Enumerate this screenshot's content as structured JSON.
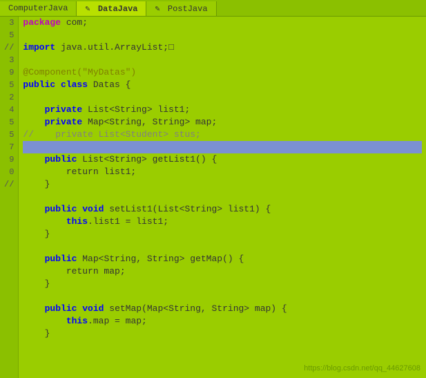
{
  "tabs": [
    {
      "label": "ComputerJava",
      "active": false,
      "icon": ""
    },
    {
      "label": "DataJava",
      "active": true,
      "icon": "✎"
    },
    {
      "label": "PostJava",
      "active": false,
      "icon": "✎"
    }
  ],
  "lines": [
    {
      "num": "",
      "code": "",
      "highlighted": false,
      "tokens": [
        {
          "text": "",
          "cls": "plain"
        }
      ]
    },
    {
      "num": "",
      "code": "package com;",
      "highlighted": false,
      "tokens": [
        {
          "text": "package",
          "cls": "kw"
        },
        {
          "text": " com;",
          "cls": "plain"
        }
      ]
    },
    {
      "num": "",
      "code": "",
      "highlighted": false,
      "tokens": []
    },
    {
      "num": "3",
      "code": "import java.util.ArrayList;□",
      "highlighted": false,
      "tokens": [
        {
          "text": "import",
          "cls": "kw2"
        },
        {
          "text": " java.util.ArrayList;□",
          "cls": "plain"
        }
      ]
    },
    {
      "num": "",
      "code": "",
      "highlighted": false,
      "tokens": []
    },
    {
      "num": "",
      "code": "@Component(\"MyDatas\")",
      "highlighted": false,
      "tokens": [
        {
          "text": "@Component(\"MyDatas\")",
          "cls": "ann"
        }
      ]
    },
    {
      "num": "",
      "code": "public class Datas {",
      "highlighted": false,
      "tokens": [
        {
          "text": "public",
          "cls": "kw2"
        },
        {
          "text": " ",
          "cls": "plain"
        },
        {
          "text": "class",
          "cls": "kw2"
        },
        {
          "text": " Datas {",
          "cls": "plain"
        }
      ]
    },
    {
      "num": "",
      "code": "",
      "highlighted": false,
      "tokens": []
    },
    {
      "num": "",
      "code": "    private List<String> list1;",
      "highlighted": false,
      "tokens": [
        {
          "text": "    ",
          "cls": "plain"
        },
        {
          "text": "private",
          "cls": "kw2"
        },
        {
          "text": " List<String> list1;",
          "cls": "plain"
        }
      ]
    },
    {
      "num": "",
      "code": "    private Map<String, String> map;",
      "highlighted": false,
      "tokens": [
        {
          "text": "    ",
          "cls": "plain"
        },
        {
          "text": "private",
          "cls": "kw2"
        },
        {
          "text": " Map<String, String> map;",
          "cls": "plain"
        }
      ]
    },
    {
      "num": "5",
      "code": "//    private List<Student> stus;",
      "highlighted": false,
      "tokens": [
        {
          "text": "//    private List<Student> stus;",
          "cls": "comment"
        }
      ]
    },
    {
      "num": "//",
      "code": "",
      "highlighted": true,
      "tokens": []
    },
    {
      "num": "",
      "code": "    public List<String> getList1() {",
      "highlighted": false,
      "tokens": [
        {
          "text": "    ",
          "cls": "plain"
        },
        {
          "text": "public",
          "cls": "kw2"
        },
        {
          "text": " List<String> getList1() {",
          "cls": "plain"
        }
      ]
    },
    {
      "num": "3",
      "code": "        return list1;",
      "highlighted": false,
      "tokens": [
        {
          "text": "        return list1;",
          "cls": "plain"
        }
      ]
    },
    {
      "num": "9",
      "code": "    }",
      "highlighted": false,
      "tokens": [
        {
          "text": "    }",
          "cls": "plain"
        }
      ]
    },
    {
      "num": "",
      "code": "",
      "highlighted": false,
      "tokens": []
    },
    {
      "num": "5",
      "code": "    public void setList1(List<String> list1) {",
      "highlighted": false,
      "tokens": [
        {
          "text": "    ",
          "cls": "plain"
        },
        {
          "text": "public",
          "cls": "kw2"
        },
        {
          "text": " ",
          "cls": "plain"
        },
        {
          "text": "void",
          "cls": "kw2"
        },
        {
          "text": " setList1(List<String> list1) {",
          "cls": "plain"
        }
      ]
    },
    {
      "num": "2",
      "code": "        this.list1 = list1;",
      "highlighted": false,
      "tokens": [
        {
          "text": "        ",
          "cls": "plain"
        },
        {
          "text": "this",
          "cls": "kw2"
        },
        {
          "text": ".list1 = list1;",
          "cls": "plain"
        }
      ]
    },
    {
      "num": "",
      "code": "    }",
      "highlighted": false,
      "tokens": [
        {
          "text": "    }",
          "cls": "plain"
        }
      ]
    },
    {
      "num": "4",
      "code": "",
      "highlighted": false,
      "tokens": []
    },
    {
      "num": "5",
      "code": "    public Map<String, String> getMap() {",
      "highlighted": false,
      "tokens": [
        {
          "text": "    ",
          "cls": "plain"
        },
        {
          "text": "public",
          "cls": "kw2"
        },
        {
          "text": " Map<String, String> getMap() {",
          "cls": "plain"
        }
      ]
    },
    {
      "num": "5",
      "code": "        return map;",
      "highlighted": false,
      "tokens": [
        {
          "text": "        return map;",
          "cls": "plain"
        }
      ]
    },
    {
      "num": "7",
      "code": "    }",
      "highlighted": false,
      "tokens": [
        {
          "text": "    }",
          "cls": "plain"
        }
      ]
    },
    {
      "num": "",
      "code": "",
      "highlighted": false,
      "tokens": []
    },
    {
      "num": "9",
      "code": "    public void setMap(Map<String, String> map) {",
      "highlighted": false,
      "tokens": [
        {
          "text": "    ",
          "cls": "plain"
        },
        {
          "text": "public",
          "cls": "kw2"
        },
        {
          "text": " ",
          "cls": "plain"
        },
        {
          "text": "void",
          "cls": "kw2"
        },
        {
          "text": " setMap(Map<String, String> map) {",
          "cls": "plain"
        }
      ]
    },
    {
      "num": "0",
      "code": "        this.map = map;",
      "highlighted": false,
      "tokens": [
        {
          "text": "        ",
          "cls": "plain"
        },
        {
          "text": "this",
          "cls": "kw2"
        },
        {
          "text": ".map = map;",
          "cls": "plain"
        }
      ]
    },
    {
      "num": "",
      "code": "    }",
      "highlighted": false,
      "tokens": [
        {
          "text": "    }",
          "cls": "plain"
        }
      ]
    },
    {
      "num": "",
      "code": "",
      "highlighted": false,
      "tokens": []
    },
    {
      "num": "//",
      "code": "",
      "highlighted": false,
      "tokens": []
    }
  ],
  "watermark": "https://blog.csdn.net/qq_44627608"
}
